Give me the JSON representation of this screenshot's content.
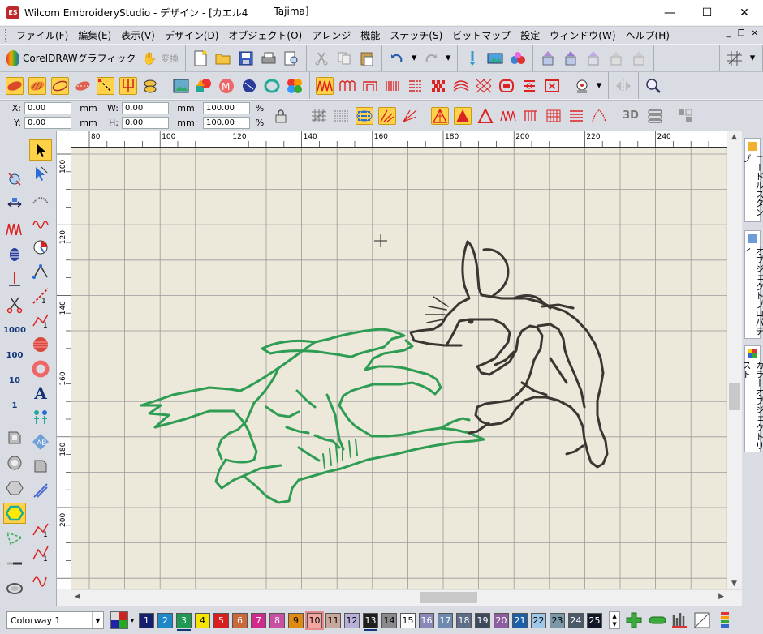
{
  "window": {
    "app_icon_text": "ES",
    "title": "Wilcom EmbroideryStudio - デザイン - [カエル4",
    "machine": "Tajima]",
    "controls": {
      "minimize": "—",
      "maximize": "☐",
      "close": "✕"
    }
  },
  "menu": {
    "items": [
      "ファイル(F)",
      "編集(E)",
      "表示(V)",
      "デザイン(D)",
      "オブジェクト(O)",
      "アレンジ",
      "機能",
      "ステッチ(S)",
      "ビットマップ",
      "設定",
      "ウィンドウ(W)",
      "ヘルプ(H)"
    ],
    "mdi": {
      "minimize": "_",
      "restore": "❐",
      "close": "✕"
    }
  },
  "toolbar": {
    "corel_label": "CorelDRAWグラフィック",
    "convert_label": "変換"
  },
  "transform": {
    "x_label": "X:",
    "x_value": "0.00",
    "x_unit": "mm",
    "y_label": "Y:",
    "y_value": "0.00",
    "y_unit": "mm",
    "w_label": "W:",
    "w_value": "0.00",
    "w_unit": "mm",
    "h_label": "H:",
    "h_value": "0.00",
    "h_unit": "mm",
    "sx_value": "100.00",
    "sy_value": "100.00",
    "pct": "%"
  },
  "left_tools": {
    "num_1000": "1000",
    "num_100": "100",
    "num_10": "10",
    "num_1": "1",
    "letter_A": "A"
  },
  "rulers": {
    "top_labels": [
      "80",
      "100",
      "120",
      "140",
      "160",
      "180",
      "200",
      "220",
      "240"
    ],
    "left_labels": [
      "100",
      "120",
      "140",
      "160",
      "180",
      "200"
    ]
  },
  "dock": {
    "tab1": "ニードルスタンプ",
    "tab2": "オブジェクトプロパティ",
    "tab3": "カラーオブジェクトリスト"
  },
  "bottom": {
    "colorway": "Colorway 1",
    "chips": [
      {
        "n": "1",
        "bg": "#14206e",
        "fg": "#ffffff"
      },
      {
        "n": "2",
        "bg": "#1e88c8",
        "fg": "#ffffff"
      },
      {
        "n": "3",
        "bg": "#1e9a52",
        "fg": "#ffffff",
        "ul": true
      },
      {
        "n": "4",
        "bg": "#f5e400",
        "fg": "#000000"
      },
      {
        "n": "5",
        "bg": "#d81e1e",
        "fg": "#ffffff"
      },
      {
        "n": "6",
        "bg": "#c86a3c",
        "fg": "#ffffff"
      },
      {
        "n": "7",
        "bg": "#d02a8c",
        "fg": "#ffffff"
      },
      {
        "n": "8",
        "bg": "#c850a0",
        "fg": "#ffffff"
      },
      {
        "n": "9",
        "bg": "#e08a14",
        "fg": "#000000"
      },
      {
        "n": "10",
        "bg": "#f2a8a0",
        "fg": "#000000",
        "sel": true
      },
      {
        "n": "11",
        "bg": "#c8a89a",
        "fg": "#000000"
      },
      {
        "n": "12",
        "bg": "#b8b0d8",
        "fg": "#000000"
      },
      {
        "n": "13",
        "bg": "#1e1e1e",
        "fg": "#ffffff",
        "ul": true
      },
      {
        "n": "14",
        "bg": "#8a8a8a",
        "fg": "#000000"
      },
      {
        "n": "15",
        "bg": "#ffffff",
        "fg": "#000000"
      },
      {
        "n": "16",
        "bg": "#8a88b8",
        "fg": "#ffffff"
      },
      {
        "n": "17",
        "bg": "#6e8ab0",
        "fg": "#ffffff"
      },
      {
        "n": "18",
        "bg": "#5e6e88",
        "fg": "#ffffff"
      },
      {
        "n": "19",
        "bg": "#3c4a5c",
        "fg": "#ffffff"
      },
      {
        "n": "20",
        "bg": "#8c5ea0",
        "fg": "#ffffff"
      },
      {
        "n": "21",
        "bg": "#1a5ea8",
        "fg": "#ffffff"
      },
      {
        "n": "22",
        "bg": "#9ec8e8",
        "fg": "#000000"
      },
      {
        "n": "23",
        "bg": "#7a98a8",
        "fg": "#000000"
      },
      {
        "n": "24",
        "bg": "#4a5a68",
        "fg": "#ffffff"
      },
      {
        "n": "25",
        "bg": "#101828",
        "fg": "#ffffff"
      }
    ]
  },
  "colors": {
    "frog_thread": "#2e9c52",
    "rabbit_thread": "#3a3632",
    "canvas_bg": "#ece8da",
    "grid": "#9a9a9a",
    "active_tool": "#ffd24a"
  }
}
